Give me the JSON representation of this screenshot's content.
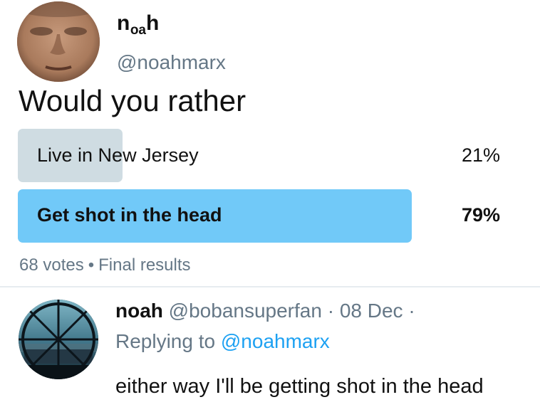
{
  "tweet": {
    "author": {
      "name_prefix": "n",
      "name_sub": "oa",
      "name_suffix": "h",
      "handle": "@noahmarx"
    },
    "text": "Would you rather",
    "poll": {
      "options": [
        {
          "label": "Live in New Jersey",
          "percent_label": "21%",
          "percent": 21,
          "winner": false
        },
        {
          "label": "Get shot in the head",
          "percent_label": "79%",
          "percent": 79,
          "winner": true
        }
      ],
      "votes": "68 votes",
      "separator": "•",
      "status": "Final results"
    }
  },
  "reply": {
    "name": "noah",
    "handle": "@bobansuperfan",
    "separator": "·",
    "date": "08 Dec",
    "trailing_separator": "·",
    "replying_prefix": "Replying to",
    "replying_handle": "@noahmarx",
    "text": "either way I'll be getting shot in the head"
  },
  "colors": {
    "winner_bar": "#71c9f8",
    "loser_bar": "#cfdce2",
    "secondary_text": "#657786",
    "link": "#1da1f2"
  },
  "icons": {
    "avatar1": "face-photo-avatar",
    "avatar2": "window-view-avatar"
  }
}
